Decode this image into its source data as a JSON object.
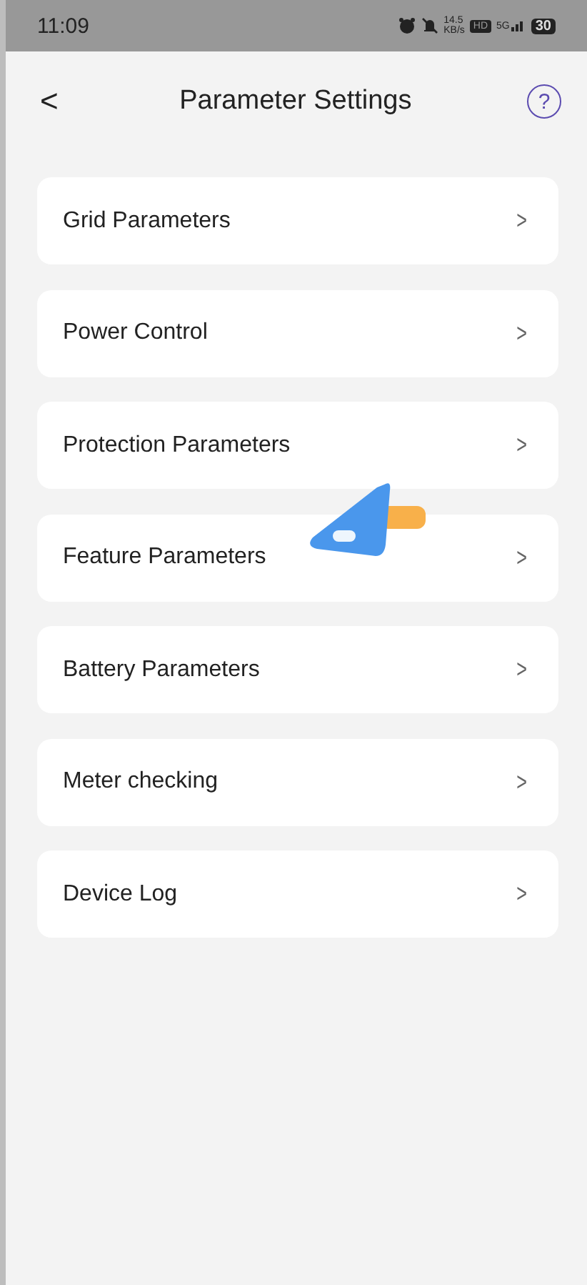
{
  "status_bar": {
    "time": "11:09",
    "speed": "14.5",
    "speed_unit": "KB/s",
    "hd": "HD",
    "network": "5G",
    "battery": "30"
  },
  "header": {
    "back": "<",
    "title": "Parameter Settings",
    "help": "?"
  },
  "items": [
    {
      "label": "Grid Parameters",
      "chevron": ">"
    },
    {
      "label": "Power Control",
      "chevron": ">"
    },
    {
      "label": "Protection Parameters",
      "chevron": ">"
    },
    {
      "label": "Feature Parameters",
      "chevron": ">"
    },
    {
      "label": "Battery Parameters",
      "chevron": ">"
    },
    {
      "label": "Meter checking",
      "chevron": ">"
    },
    {
      "label": "Device Log",
      "chevron": ">"
    }
  ]
}
